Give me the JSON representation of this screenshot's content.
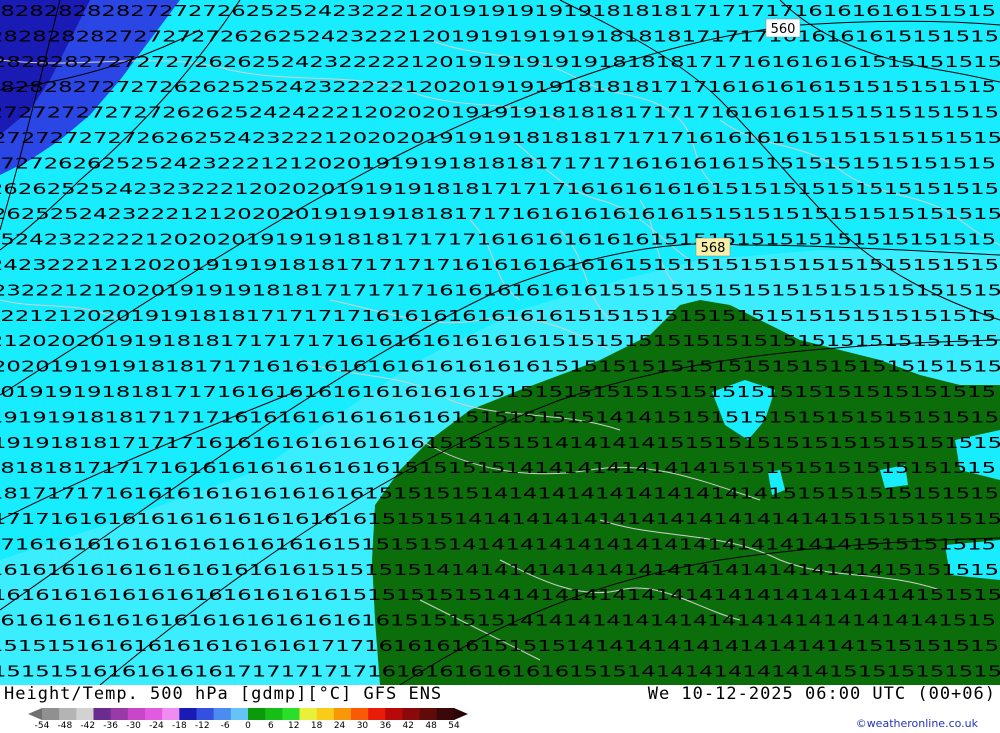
{
  "header": {
    "title": "Height/Temp. 500 hPa [gdmp][°C] GFS ENS",
    "valid_time": "We 10-12-2025 06:00 UTC (00+06)",
    "credit": "©weatheronline.co.uk"
  },
  "legend": {
    "ticks": [
      "-54",
      "-48",
      "-42",
      "-36",
      "-30",
      "-24",
      "-18",
      "-12",
      "-6",
      "0",
      "6",
      "12",
      "18",
      "24",
      "30",
      "36",
      "42",
      "48",
      "54"
    ],
    "colors": [
      "#909090",
      "#b4b4b4",
      "#d2d2d2",
      "#6a2c8e",
      "#9a3aa8",
      "#c846c8",
      "#e25ae0",
      "#f08cf0",
      "#1a1ab4",
      "#3450e0",
      "#4c8cf0",
      "#64c4f8",
      "#0a9a0a",
      "#16be16",
      "#2ade2a",
      "#e8f03c",
      "#f8cc18",
      "#f89808",
      "#f85a08",
      "#e81c08",
      "#b80808",
      "#8a0a0a",
      "#600a0a",
      "#3a0808"
    ],
    "left_arrow_color": "#707070",
    "right_arrow_color": "#2a0606"
  },
  "map": {
    "colors": {
      "cyan": "#18ecff",
      "light_cyan": "#7af4ff",
      "blue": "#2040e0",
      "deep_blue": "#1a1ab4",
      "green": "#0b6e0b",
      "coast": "#c8c8c8",
      "contour": "#000000"
    },
    "contour_labels": [
      {
        "text": "560"
      },
      {
        "text": "568"
      }
    ],
    "temperature_rows": [
      "2828282828272727262525242322212019191919191818181717171716161616151515",
      "2828282827272727262625242322212019191919191818181717171616161615151515",
      "2828282727272726262524232222212019191919191818181717161616161515151515",
      "2828282727272626252524232222212020191919181818171716161616151515151515",
      "2727272727272626252424222120202019191918181817171716161615151515151515",
      "2727272727262625242322212020201919191818181717171616161615151515151515",
      "2727262625252423222121202019191918181817171716161616151515151515151515",
      "2626252524232322212020201919191818171717161616161615151515151515151515",
      "2625252423222121202020191919181817171616161616161515151515151515151515",
      "2524232222212020201919191818171717161616161616151515151515151515151515",
      "2423222121202019191918181717171716161616161615151515151515151515151515",
      "2322212120201919191818171717171616161616161515151515151515151515151515",
      "2221212020191918181717171716161616161616151515151515151515151515151515",
      "2120202019191818171717171616161616161615151515151515151515151515151515",
      "2020191919181817171616161616161616161615151515151515151515151515151515",
      "2019191918181717161616161616161616151515151515151515151515151515151515",
      "1919191818171717161616161616161615151515151414151515151515151515151515",
      "1919181817171716161616161616161515151514141414151515151515151515151515",
      "1818181717171616161616161616151515151414141414141415151515151515151515",
      "1817171716161616161616161615151515141414141414141414141515151515151515",
      "1717161616161616161616161615151514141414141414141414141414151515151515",
      "1716161616161616161616161515151514141414141414141414141414141515151515",
      "1616161616161616161616151515151414141414141414141414141414141415151515",
      "1616161616161616161616161515151515141414141414141414141414141414151515",
      "1616161616161616161616161616151515151414141414141414141414141414141515",
      "1515151616161616161616171716161616151515141414141414141414141515151515",
      "1515151616161616171717171716161616161616151514141414141414151515151515"
    ]
  }
}
